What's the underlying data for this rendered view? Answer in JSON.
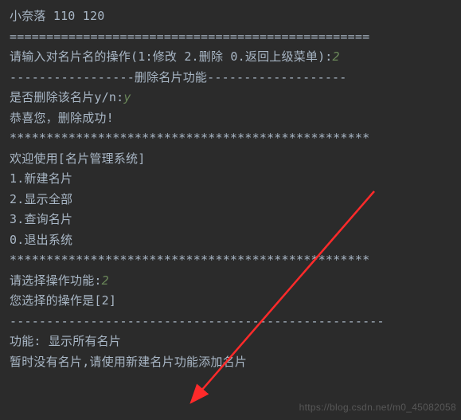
{
  "line1_name": "小奈落",
  "line1_num1": "110",
  "line1_num2": "120",
  "sep_eq": "=================================================",
  "prompt_op": "请输入对名片名的操作(1:修改 2.删除 0.返回上级菜单):",
  "prompt_op_input": "2",
  "delete_header": "-----------------删除名片功能-------------------",
  "confirm_delete": "是否删除该名片y/n:",
  "confirm_delete_input": "y",
  "delete_success": "恭喜您，删除成功!",
  "sep_star": "*************************************************",
  "welcome": "欢迎使用[名片管理系统]",
  "menu1": "1.新建名片",
  "menu2": "2.显示全部",
  "menu3": "3.查询名片",
  "menu0": "0.退出系统",
  "choose_prompt": "请选择操作功能:",
  "choose_input": "2",
  "your_choice": "您选择的操作是[2]",
  "sep_dash": "---------------------------------------------------",
  "func_title": "功能: 显示所有名片",
  "no_card": "暂时没有名片,请使用新建名片功能添加名片",
  "watermark": "https://blog.csdn.net/m0_45082058"
}
